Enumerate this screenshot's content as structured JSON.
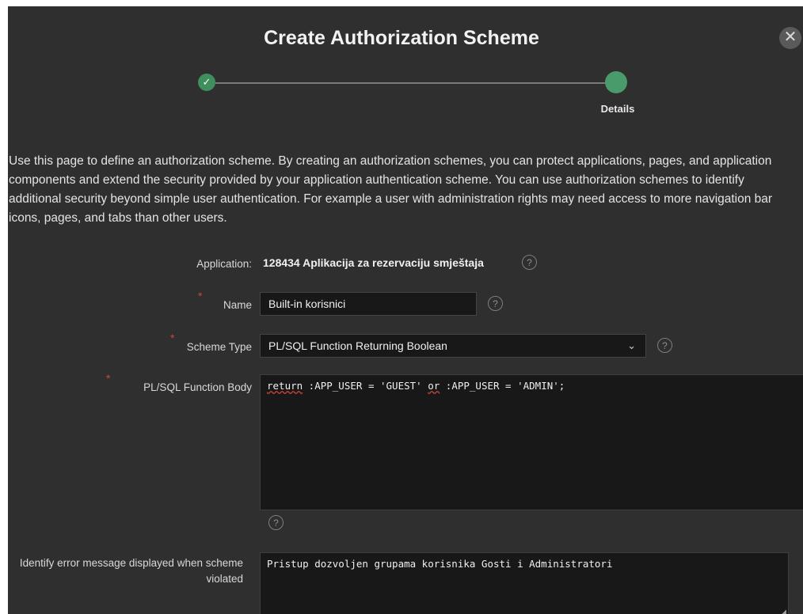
{
  "dialog": {
    "title": "Create Authorization Scheme",
    "close_icon": "✕",
    "wizard": {
      "step_done_icon": "✓",
      "current_step_label": "Details"
    },
    "intro": "Use this page to define an authorization scheme. By creating an authorization schemes, you can protect applications, pages, and application components and extend the security provided by your application authentication scheme. You can use authorization schemes to identify additional security beyond simple user authentication. For example a user with administration rights may need access to more navigation bar icons, pages, and tabs than other users.",
    "required_mark": "*",
    "help_icon": "?",
    "fields": {
      "application": {
        "label": "Application:",
        "value": "128434 Aplikacija za rezervaciju smještaja"
      },
      "name": {
        "label": "Name",
        "value": "Built-in korisnici"
      },
      "scheme_type": {
        "label": "Scheme Type",
        "value": "PL/SQL Function Returning Boolean",
        "chevron": "⌄"
      },
      "plsql_body": {
        "label": "PL/SQL Function Body",
        "tokens": [
          "return",
          " :APP_USER = 'GUEST' ",
          "or",
          " :APP_USER = 'ADMIN';"
        ]
      },
      "error_message": {
        "label": "Identify error message displayed when scheme violated",
        "value": "Pristup dozvoljen grupama korisnika Gosti i Administratori",
        "resize_icon": "◢"
      }
    }
  }
}
